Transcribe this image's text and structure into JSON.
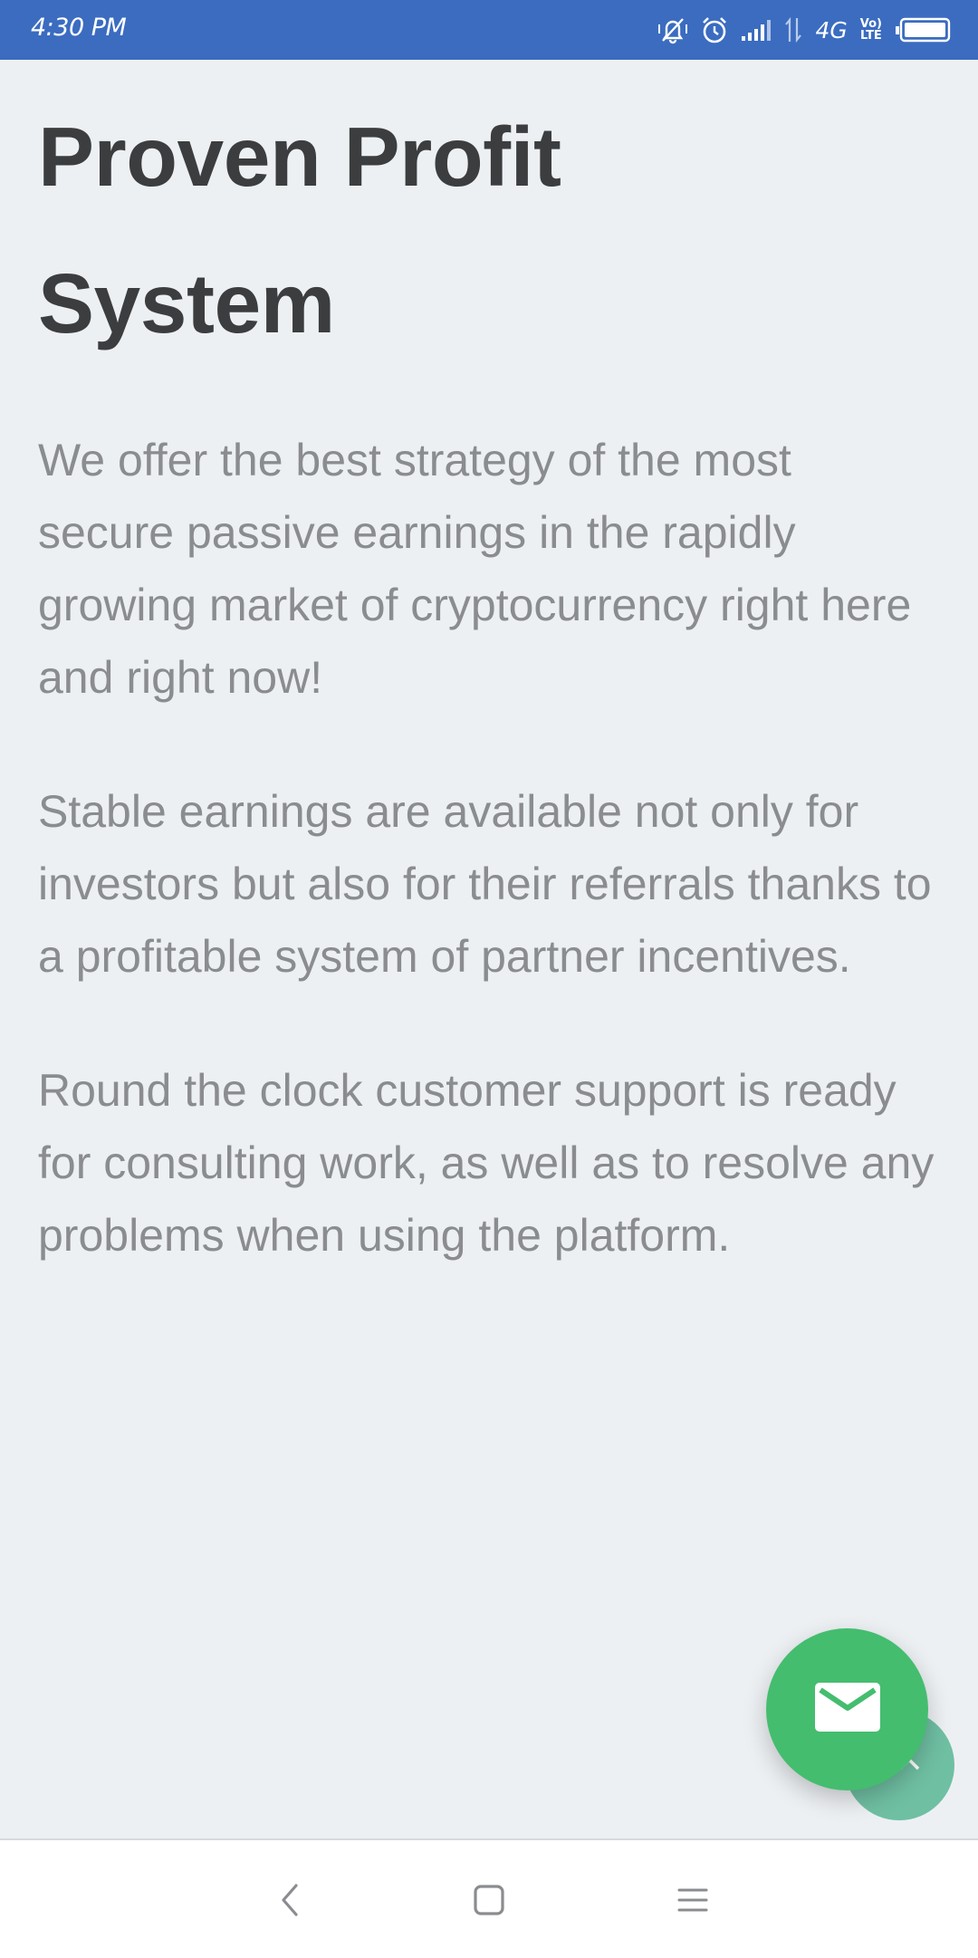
{
  "status_bar": {
    "time": "4:30 PM",
    "network": "4G",
    "volte_top": "Vo)",
    "volte_bottom": "LTE",
    "icons": [
      "mute-vibrate-icon",
      "alarm-icon",
      "signal-icon",
      "data-arrows-icon",
      "battery-icon"
    ]
  },
  "page": {
    "title_line1": "Proven Profit",
    "title_line2": "System",
    "paragraphs": [
      "We offer the best strategy of the most secure passive earnings in the rapidly growing market of cryptocurrency right here and right now!",
      "Stable earnings are available not only for investors but also for their referrals thanks to a profitable system of partner incentives.",
      "Round the clock customer support is ready for consulting work, as well as to resolve any problems when using the platform."
    ]
  },
  "floating": {
    "contact_icon": "mail-icon",
    "scroll_top_icon": "chevron-up-icon"
  },
  "nav_bar": {
    "buttons": [
      "back-icon",
      "home-icon",
      "menu-icon"
    ]
  },
  "colors": {
    "status_bar": "#3b6cc0",
    "background": "#edf0f3",
    "title": "#3c3d3f",
    "body_text": "#8a8c90",
    "fab": "#44bd6f",
    "scroll_top": "#6fbfa3"
  }
}
